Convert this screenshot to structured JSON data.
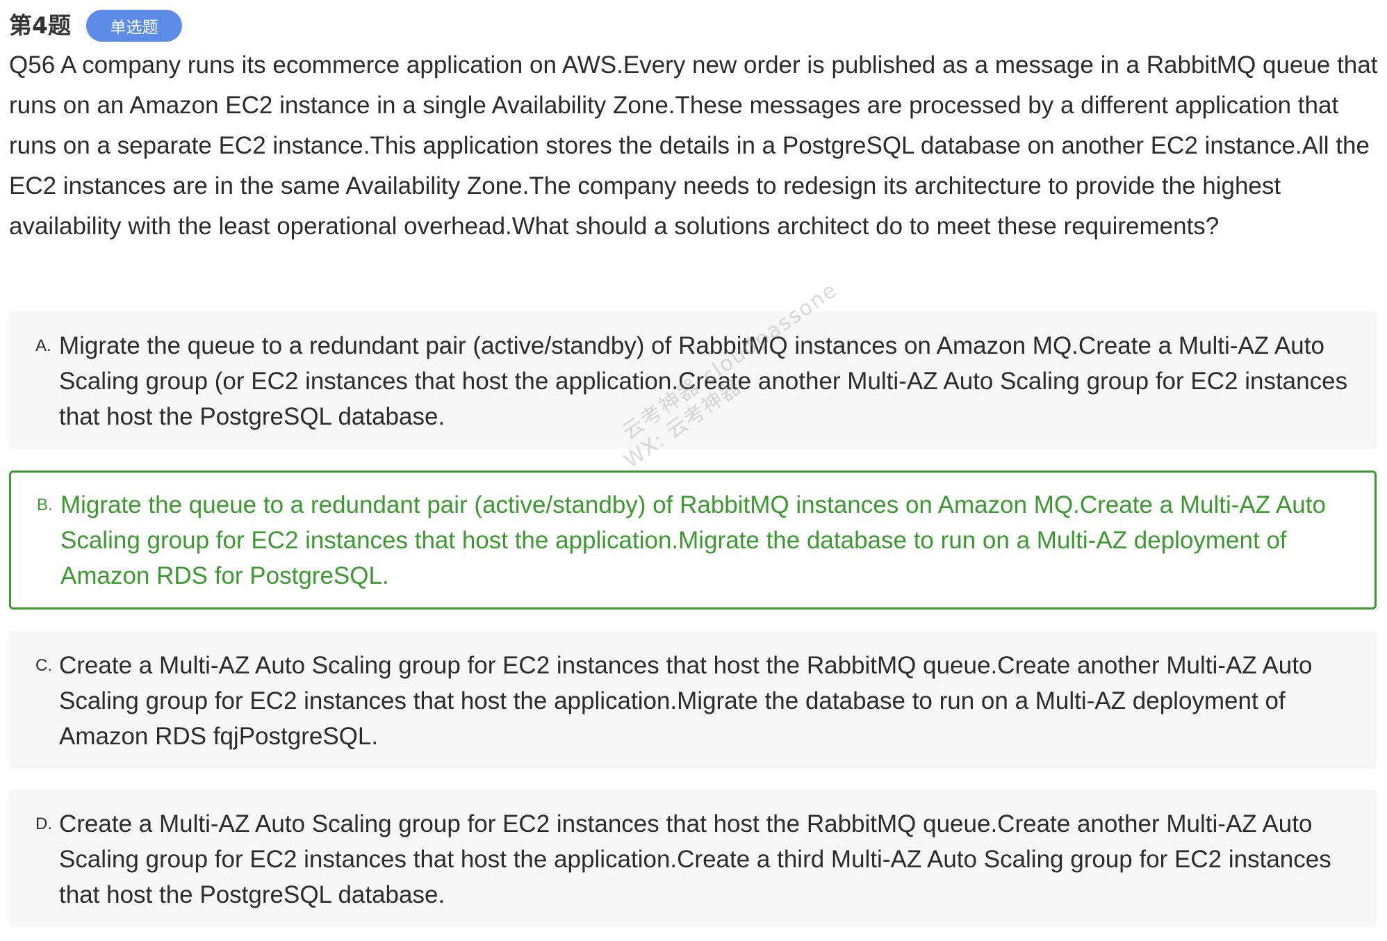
{
  "header": {
    "question_number": "第4题",
    "question_type": "单选题"
  },
  "question": {
    "text": "Q56 A company runs its ecommerce application on AWS.Every new order is published as a message in a RabbitMQ queue that runs on an Amazon EC2 instance in a single Availability Zone.These messages are processed by a different application that runs on a separate EC2 instance.This application stores the details in a PostgreSQL database on another EC2 instance.All the EC2 instances are in the same Availability Zone.The company needs to redesign its architecture to provide the highest availability with the least operational overhead.What should a solutions architect do to meet these requirements?"
  },
  "options": [
    {
      "letter": "A.",
      "text": "Migrate the queue to a redundant pair (active/standby) of RabbitMQ instances on Amazon MQ.Create a Multi-AZ Auto Scaling group (or EC2 instances that host the application.Create another Multi-AZ Auto Scaling group for EC2 instances that host the PostgreSQL database.",
      "selected": false
    },
    {
      "letter": "B.",
      "text": "Migrate the queue to a redundant pair (active/standby) of RabbitMQ instances on Amazon MQ.Create a Multi-AZ Auto Scaling group for EC2 instances that host the application.Migrate the database to run on a Multi-AZ deployment of Amazon RDS for PostgreSQL.",
      "selected": true
    },
    {
      "letter": "C.",
      "text": "Create a Multi-AZ Auto Scaling group for EC2 instances that host the RabbitMQ queue.Create another Multi-AZ Auto Scaling group for EC2 instances that host the application.Migrate the database to run on a Multi-AZ deployment of Amazon RDS fqjPostgreSQL.",
      "selected": false
    },
    {
      "letter": "D.",
      "text": "Create a Multi-AZ Auto Scaling group for EC2 instances that host the RabbitMQ queue.Create another Multi-AZ Auto Scaling group for EC2 instances that host the application.Create a third Multi-AZ Auto Scaling group for EC2 instances that host the PostgreSQL database.",
      "selected": false
    }
  ],
  "watermark": {
    "line1": "云考神器 cloudpassone",
    "line2": "WX: 云考神器"
  },
  "colors": {
    "badge": "#5c8ce8",
    "selected": "#3b9a2f",
    "option_background": "#f7f7f7",
    "text": "#2b2b2b"
  }
}
